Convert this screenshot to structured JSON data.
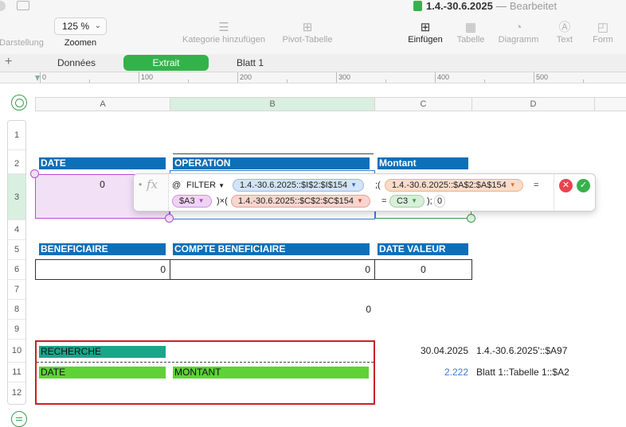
{
  "window": {
    "title": "1.4.-30.6.2025",
    "separator": "—",
    "status": "Bearbeitet"
  },
  "toolbar": {
    "darstellung": "Darstellung",
    "zoom_value": "125 %",
    "zoom_label": "Zoomen",
    "kategorie": "Kategorie hinzufügen",
    "pivot": "Pivot-Tabelle",
    "einfuegen": "Einfügen",
    "tabelle": "Tabelle",
    "diagramm": "Diagramm",
    "text": "Text",
    "form": "Form"
  },
  "sheets": [
    {
      "label": "Données",
      "active": false
    },
    {
      "label": "Extrait",
      "active": true
    },
    {
      "label": "Blatt 1",
      "active": false
    }
  ],
  "ruler": [
    "0",
    "100",
    "200",
    "300",
    "400",
    "500"
  ],
  "columns": [
    "A",
    "B",
    "C",
    "D"
  ],
  "rows": [
    "1",
    "2",
    "3",
    "4",
    "5",
    "6",
    "7",
    "8",
    "9",
    "10",
    "11",
    "12"
  ],
  "headers": {
    "date": "DATE",
    "operation": "OPERATION",
    "montant": "Montant",
    "beneficiaire": "BENEFICIAIRE",
    "compte_beneficiaire": "COMPTE BENEFICIAIRE",
    "date_valeur": "DATE VALEUR"
  },
  "cells": {
    "a3": "0",
    "a6": "0",
    "b6": "0",
    "c6": "0",
    "b8": "0",
    "c10": "30.04.2025",
    "d10": "1.4.-30.6.2025'::$A97",
    "c11": "2.222",
    "d11": "Blatt 1::Tabelle 1::$A2"
  },
  "formula": {
    "at": "@",
    "function": "FILTER",
    "range1": "1.4.-30.6.2025::$I$2:$I$154",
    "sep1": ";(",
    "range2": "1.4.-30.6.2025::$A$2:$A$154",
    "eq1": "=",
    "ref_a3": "$A3",
    "mult": ")×(",
    "range3": "1.4.-30.6.2025::$C$2:$C$154",
    "eq2": "=",
    "ref_c3": "C3",
    "close": ");",
    "arg_last": "0"
  },
  "lookup_table": {
    "recherche": "RECHERCHE",
    "date": "DATE",
    "montant": "MONTANT"
  },
  "colors": {
    "header_blue": "#0d6fb8",
    "sheet_active": "#33b24a",
    "recherche_teal": "#1aa58a",
    "row_green": "#5ed236",
    "outline_red": "#c72127",
    "value_blue": "#3b7bd6"
  }
}
